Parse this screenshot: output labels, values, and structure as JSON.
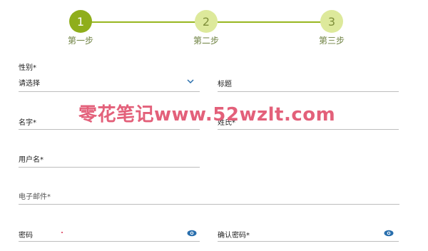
{
  "stepper": {
    "steps": [
      {
        "number": "1",
        "label": "第一步",
        "state": "active"
      },
      {
        "number": "2",
        "label": "第二步",
        "state": "inactive"
      },
      {
        "number": "3",
        "label": "第三步",
        "state": "inactive"
      }
    ],
    "colors": {
      "active": "#8fae1b",
      "inactive": "#dde99b",
      "line": "#98b620"
    }
  },
  "form": {
    "gender": {
      "label": "性别*",
      "value": "请选择"
    },
    "title": {
      "label": "标题"
    },
    "first_name": {
      "label": "名字*"
    },
    "last_name": {
      "label": "姓氏*"
    },
    "username": {
      "label": "用户名*"
    },
    "email": {
      "label": "电子邮件*"
    },
    "password": {
      "label": "密码"
    },
    "confirm_password": {
      "label": "确认密码*"
    }
  },
  "watermark": {
    "text": "零花笔记www.52wzlt.com"
  },
  "icons": {
    "dropdown": "chevron-down-icon",
    "reveal": "eye-icon"
  }
}
